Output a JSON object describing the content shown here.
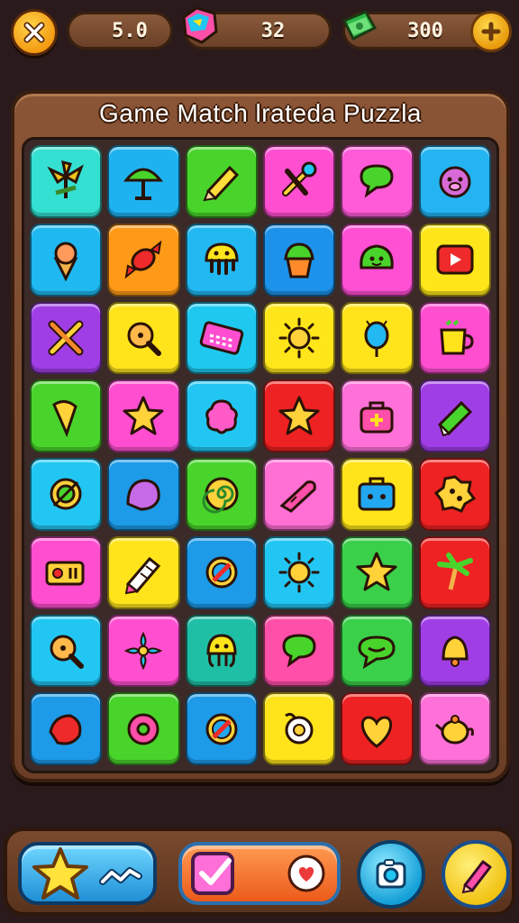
{
  "hud": {
    "moves_value": "5.0",
    "gems_value": "32",
    "cash_value": "300"
  },
  "board": {
    "title": "Game Match lrateda Puzzla"
  },
  "tiles": [
    {
      "color": "#34e0d2",
      "icon": "palm-leaf-icon"
    },
    {
      "color": "#1fb2f0",
      "icon": "umbrella-icon"
    },
    {
      "color": "#49d42c",
      "icon": "pencil-icon"
    },
    {
      "color": "#ff4fd0",
      "icon": "tools-icon"
    },
    {
      "color": "#ff5bd8",
      "icon": "chat-bubble-icon"
    },
    {
      "color": "#25b4f2",
      "icon": "pig-icon"
    },
    {
      "color": "#1fb8f0",
      "icon": "ice-cream-icon"
    },
    {
      "color": "#ff9a18",
      "icon": "candy-icon"
    },
    {
      "color": "#22b8f2",
      "icon": "jellyfish-icon"
    },
    {
      "color": "#1d92ea",
      "icon": "cupcake-icon"
    },
    {
      "color": "#ff4fd3",
      "icon": "slime-icon"
    },
    {
      "color": "#ffe61a",
      "icon": "play-button-icon"
    },
    {
      "color": "#a03ee6",
      "icon": "crossed-tools-icon"
    },
    {
      "color": "#ffe41c",
      "icon": "magnifier-icon"
    },
    {
      "color": "#1ec8ee",
      "icon": "keyboard-icon"
    },
    {
      "color": "#ffe61a",
      "icon": "sun-icon"
    },
    {
      "color": "#ffe41c",
      "icon": "balloon-icon"
    },
    {
      "color": "#ff4fd0",
      "icon": "mug-icon"
    },
    {
      "color": "#49d42c",
      "icon": "cone-icon"
    },
    {
      "color": "#ff4fd0",
      "icon": "star-icon"
    },
    {
      "color": "#22c6f2",
      "icon": "flower-blob-icon"
    },
    {
      "color": "#ee2222",
      "icon": "star-icon"
    },
    {
      "color": "#ff70d8",
      "icon": "first-aid-bag-icon"
    },
    {
      "color": "#a03ee6",
      "icon": "eraser-icon"
    },
    {
      "color": "#22c6f2",
      "icon": "ring-icon"
    },
    {
      "color": "#1d9ae8",
      "icon": "gumdrop-icon"
    },
    {
      "color": "#49d42c",
      "icon": "spiral-icon"
    },
    {
      "color": "#ff6fd4",
      "icon": "carrot-icon"
    },
    {
      "color": "#ffe41c",
      "icon": "suitcase-icon"
    },
    {
      "color": "#ee2222",
      "icon": "cookie-icon"
    },
    {
      "color": "#ff4fd0",
      "icon": "battery-icon"
    },
    {
      "color": "#ffe41c",
      "icon": "ruler-pencil-icon"
    },
    {
      "color": "#1d9ae8",
      "icon": "no-sign-icon"
    },
    {
      "color": "#22c6f2",
      "icon": "sun-icon"
    },
    {
      "color": "#3ad04a",
      "icon": "star-icon"
    },
    {
      "color": "#ee2222",
      "icon": "palm-tree-icon"
    },
    {
      "color": "#22c6f2",
      "icon": "magnifier-icon"
    },
    {
      "color": "#ff4fd0",
      "icon": "flower-icon"
    },
    {
      "color": "#1fbfa6",
      "icon": "octopus-icon"
    },
    {
      "color": "#ff4fa8",
      "icon": "chat-bubble-icon"
    },
    {
      "color": "#3ad04a",
      "icon": "speech-bubble-icon"
    },
    {
      "color": "#a03ee6",
      "icon": "bell-icon"
    },
    {
      "color": "#1d9ae8",
      "icon": "leaf-icon"
    },
    {
      "color": "#49d42c",
      "icon": "donut-icon"
    },
    {
      "color": "#1d9ae8",
      "icon": "no-sign-icon"
    },
    {
      "color": "#ffe41c",
      "icon": "pacifier-icon"
    },
    {
      "color": "#ee2222",
      "icon": "heart-icon"
    },
    {
      "color": "#ff70d8",
      "icon": "teapot-icon"
    }
  ]
}
